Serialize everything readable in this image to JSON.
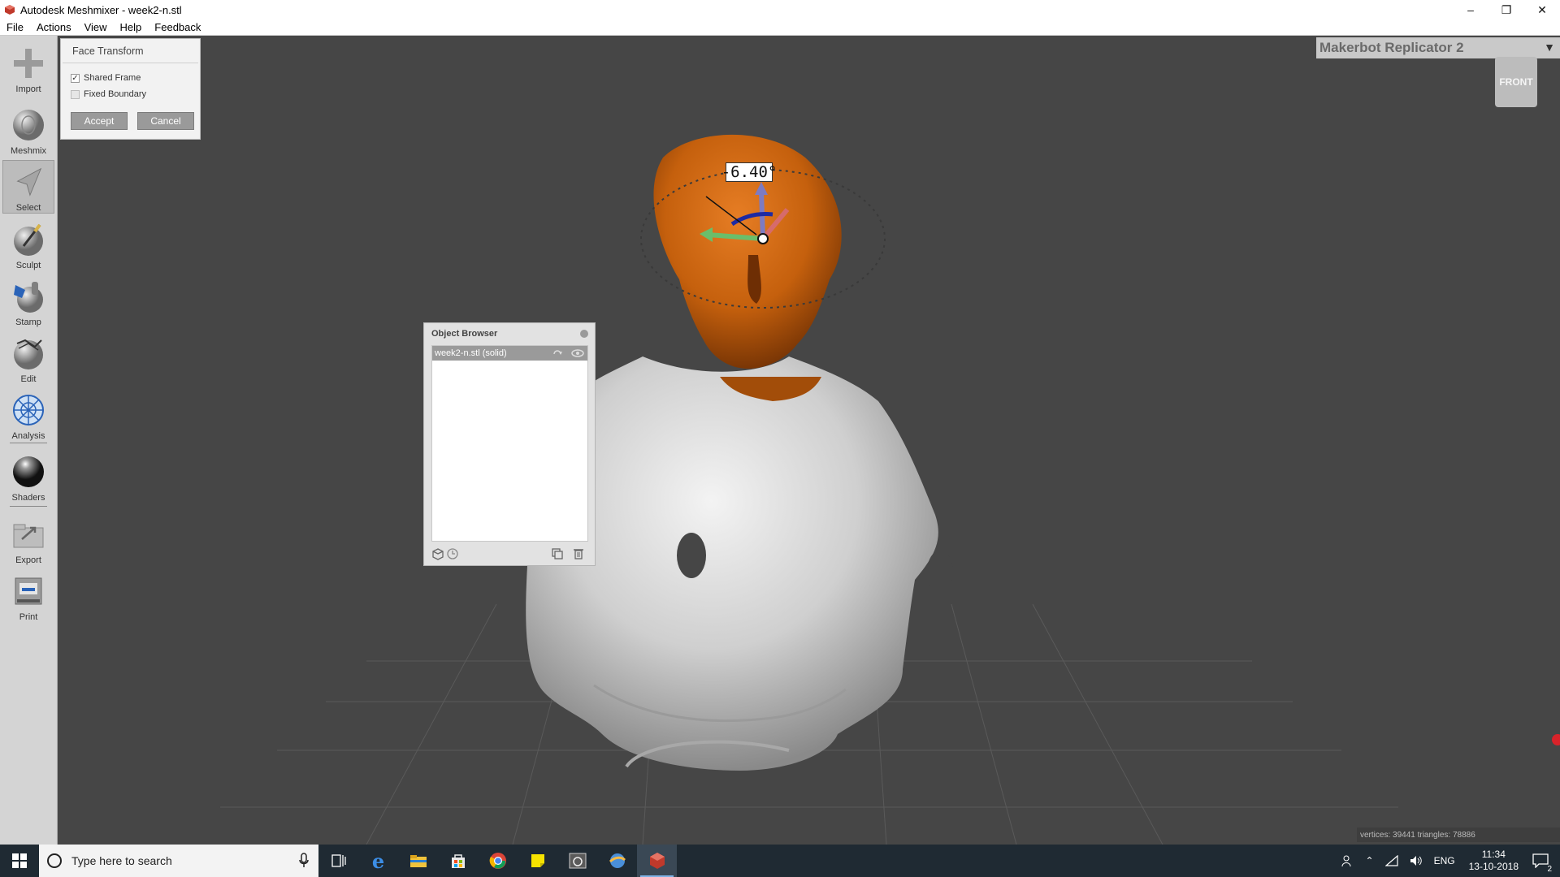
{
  "window": {
    "title": "Autodesk Meshmixer - week2-n.stl",
    "minimize_glyph": "–",
    "restore_glyph": "❐",
    "close_glyph": "✕"
  },
  "menu": [
    "File",
    "Actions",
    "View",
    "Help",
    "Feedback"
  ],
  "toolbar": {
    "import": "Import",
    "meshmix": "Meshmix",
    "select": "Select",
    "sculpt": "Sculpt",
    "stamp": "Stamp",
    "edit": "Edit",
    "analysis": "Analysis",
    "shaders": "Shaders",
    "export": "Export",
    "print": "Print"
  },
  "face_transform": {
    "title": "Face Transform",
    "shared_frame_label": "Shared Frame",
    "shared_frame_checked": true,
    "fixed_boundary_label": "Fixed Boundary",
    "fixed_boundary_checked": false,
    "accept_label": "Accept",
    "cancel_label": "Cancel"
  },
  "printer": {
    "name": "Makerbot Replicator 2"
  },
  "viewcube": {
    "face": "FRONT"
  },
  "gizmo": {
    "angle_label": "-6.40°"
  },
  "object_browser": {
    "title": "Object Browser",
    "items": [
      {
        "label": "week2-n.stl (solid)"
      }
    ]
  },
  "status": {
    "text": "vertices: 39441 triangles: 78886"
  },
  "taskbar": {
    "search_placeholder": "Type here to search",
    "language": "ENG",
    "time": "11:34",
    "date": "13-10-2018",
    "notifications": "2"
  },
  "colors": {
    "selection_orange": "#c5600d",
    "mesh_grey": "#d0d0d0",
    "viewport_bg": "#464646",
    "taskbar_bg": "#1f2a33"
  }
}
